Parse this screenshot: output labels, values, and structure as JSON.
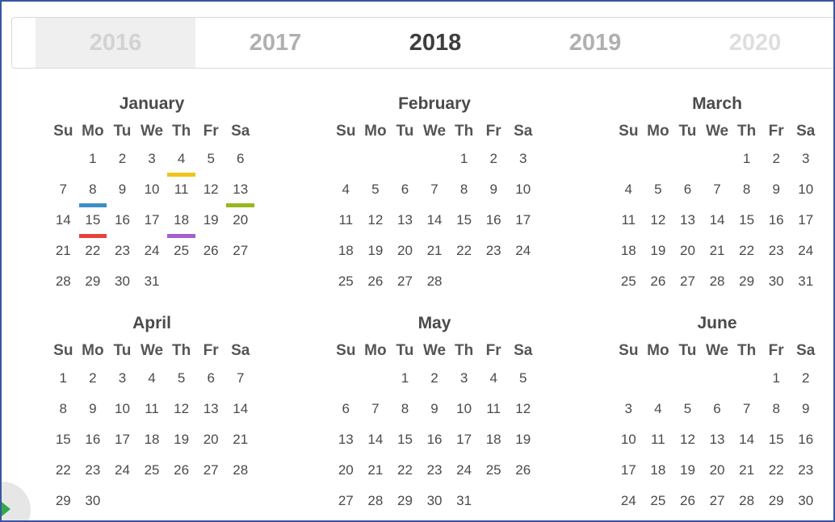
{
  "years": [
    {
      "label": "2016",
      "state": "prev"
    },
    {
      "label": "2017",
      "state": "near"
    },
    {
      "label": "2018",
      "state": "current"
    },
    {
      "label": "2019",
      "state": "near"
    },
    {
      "label": "2020",
      "state": "far"
    }
  ],
  "weekdays": [
    "Su",
    "Mo",
    "Tu",
    "We",
    "Th",
    "Fr",
    "Sa"
  ],
  "months": [
    {
      "name": "January",
      "weeks": [
        [
          "",
          "1",
          "2",
          "3",
          "4",
          "5",
          "6"
        ],
        [
          "7",
          "8",
          "9",
          "10",
          "11",
          "12",
          "13"
        ],
        [
          "14",
          "15",
          "16",
          "17",
          "18",
          "19",
          "20"
        ],
        [
          "21",
          "22",
          "23",
          "24",
          "25",
          "26",
          "27"
        ],
        [
          "28",
          "29",
          "30",
          "31",
          "",
          "",
          ""
        ]
      ],
      "marks": {
        "4": "#f0c419",
        "8": "#3b8fc7",
        "13": "#97b81c",
        "15": "#e8413a",
        "18": "#a65ed1"
      }
    },
    {
      "name": "February",
      "weeks": [
        [
          "",
          "",
          "",
          "",
          "1",
          "2",
          "3"
        ],
        [
          "4",
          "5",
          "6",
          "7",
          "8",
          "9",
          "10"
        ],
        [
          "11",
          "12",
          "13",
          "14",
          "15",
          "16",
          "17"
        ],
        [
          "18",
          "19",
          "20",
          "21",
          "22",
          "23",
          "24"
        ],
        [
          "25",
          "26",
          "27",
          "28",
          "",
          "",
          ""
        ]
      ],
      "marks": {}
    },
    {
      "name": "March",
      "weeks": [
        [
          "",
          "",
          "",
          "",
          "1",
          "2",
          "3"
        ],
        [
          "4",
          "5",
          "6",
          "7",
          "8",
          "9",
          "10"
        ],
        [
          "11",
          "12",
          "13",
          "14",
          "15",
          "16",
          "17"
        ],
        [
          "18",
          "19",
          "20",
          "21",
          "22",
          "23",
          "24"
        ],
        [
          "25",
          "26",
          "27",
          "28",
          "29",
          "30",
          "31"
        ]
      ],
      "marks": {}
    },
    {
      "name": "April",
      "weeks": [
        [
          "1",
          "2",
          "3",
          "4",
          "5",
          "6",
          "7"
        ],
        [
          "8",
          "9",
          "10",
          "11",
          "12",
          "13",
          "14"
        ],
        [
          "15",
          "16",
          "17",
          "18",
          "19",
          "20",
          "21"
        ],
        [
          "22",
          "23",
          "24",
          "25",
          "26",
          "27",
          "28"
        ],
        [
          "29",
          "30",
          "",
          "",
          "",
          "",
          ""
        ]
      ],
      "marks": {}
    },
    {
      "name": "May",
      "weeks": [
        [
          "",
          "",
          "1",
          "2",
          "3",
          "4",
          "5"
        ],
        [
          "6",
          "7",
          "8",
          "9",
          "10",
          "11",
          "12"
        ],
        [
          "13",
          "14",
          "15",
          "16",
          "17",
          "18",
          "19"
        ],
        [
          "20",
          "21",
          "22",
          "23",
          "24",
          "25",
          "26"
        ],
        [
          "27",
          "28",
          "29",
          "30",
          "31",
          "",
          ""
        ]
      ],
      "marks": {}
    },
    {
      "name": "June",
      "weeks": [
        [
          "",
          "",
          "",
          "",
          "",
          "1",
          "2"
        ],
        [
          "3",
          "4",
          "5",
          "6",
          "7",
          "8",
          "9"
        ],
        [
          "10",
          "11",
          "12",
          "13",
          "14",
          "15",
          "16"
        ],
        [
          "17",
          "18",
          "19",
          "20",
          "21",
          "22",
          "23"
        ],
        [
          "24",
          "25",
          "26",
          "27",
          "28",
          "29",
          "30"
        ]
      ],
      "marks": {}
    }
  ]
}
